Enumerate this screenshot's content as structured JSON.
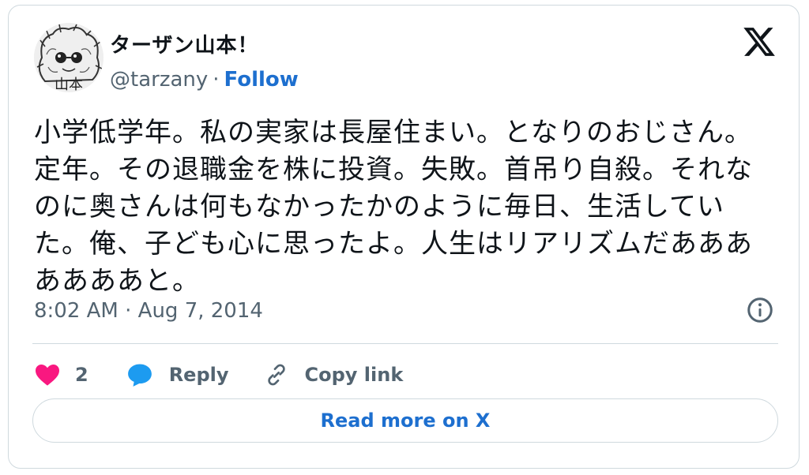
{
  "author": {
    "display_name": "ターザン山本！",
    "handle": "@tarzany",
    "separator": "·",
    "follow_label": "Follow",
    "avatar_text": "山本"
  },
  "tweet": {
    "text": "小学低学年。私の実家は長屋住まい。となりのおじさん。定年。その退職金を株に投資。失敗。首吊り自殺。それなのに奥さんは何もなかったかのように毎日、生活していた。俺、子ども心に思ったよ。人生はリアリズムだあああああああと。",
    "timestamp": "8:02 AM · Aug 7, 2014"
  },
  "actions": {
    "like_count": "2",
    "reply_label": "Reply",
    "copy_link_label": "Copy link"
  },
  "footer": {
    "read_more_label": "Read more on X"
  },
  "colors": {
    "link_blue": "#1d6fcf",
    "heart_red": "#f91880",
    "reply_blue": "#1d9bf0",
    "muted_gray": "#536471",
    "border": "#cfd9de"
  },
  "icons": {
    "brand": "x-logo-icon",
    "info": "info-icon",
    "like": "heart-icon",
    "reply": "speech-bubble-icon",
    "copy_link": "link-icon"
  }
}
